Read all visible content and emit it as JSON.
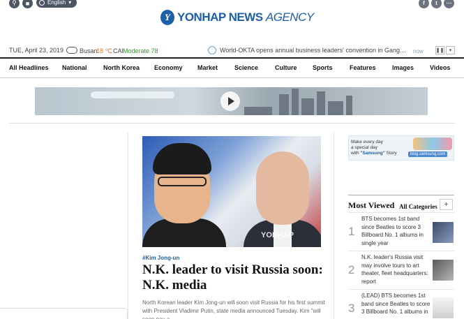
{
  "header": {
    "language": "English",
    "logo_bold": "YONHAP NEWS",
    "logo_light": "AGENCY",
    "logo_mark": "Y",
    "social": [
      "f",
      "t",
      "⋯"
    ]
  },
  "infobar": {
    "date": "TUE, April 23, 2019",
    "city": "Busan",
    "temperature": "18 ℃",
    "air_label": "CAI",
    "air_value": "Moderate 78",
    "ticker": "World-OKTA opens annual business leaders' convention in Gangwon Pr...",
    "now": "now"
  },
  "nav": {
    "items": [
      "All Headlines",
      "National",
      "North Korea",
      "Economy",
      "Market",
      "Science",
      "Culture",
      "Sports",
      "Features",
      "Images",
      "Videos"
    ]
  },
  "main_story": {
    "tag": "#Kim Jong-un",
    "headline": "N.K. leader to visit Russia soon: N.K. media",
    "summary": "North Korean leader Kim Jong-un will soon visit Russia for his first summit with President Vladimir Putin, state media announced Tuesday. Kim \"will soon pay a",
    "watermark": "YONHAP"
  },
  "ad": {
    "line1": "Make every day",
    "line2": "a special day",
    "line3_pre": "with ",
    "line3_brand": "\"Samsung\"",
    "line3_post": " Story",
    "blog": "blog.samsung.com"
  },
  "most_viewed": {
    "title": "Most Viewed",
    "category": "All Categories",
    "more": "+",
    "items": [
      {
        "rank": "1",
        "text": "BTS becomes 1st band since Beatles to score 3 Billboard No. 1 albums in single year"
      },
      {
        "rank": "2",
        "text": "N.K. leader's Russia visit may involve tours to art theater, fleet headquarters: report"
      },
      {
        "rank": "3",
        "text": "(LEAD) BTS becomes 1st band since Beatles to score 3 Billboard No. 1 albums in"
      }
    ]
  },
  "colors": {
    "brand": "#1f5fa8",
    "temp": "#e0772b",
    "air": "#3a9a3a"
  }
}
